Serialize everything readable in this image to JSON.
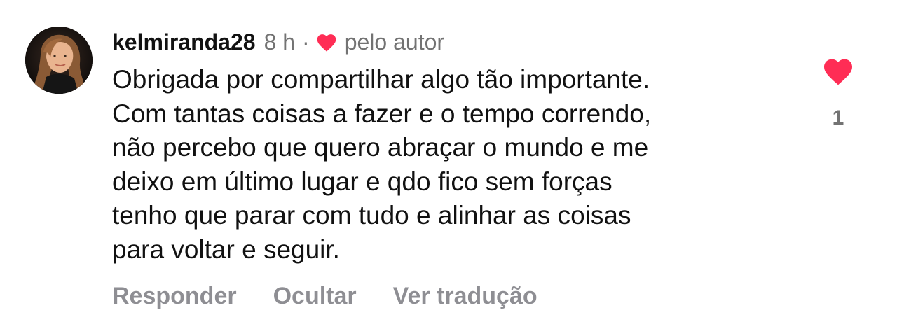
{
  "comment": {
    "username": "kelmiranda28",
    "time": "8 h",
    "separator": "·",
    "author_label": "pelo autor",
    "text_lines": [
      "Obrigada por compartilhar algo tão importante.",
      "Com tantas coisas a fazer e o tempo correndo,",
      "não percebo que quero abraçar o mundo e me",
      "deixo em último lugar e qdo fico sem forças",
      "tenho que parar com tudo e alinhar as coisas",
      "para voltar e seguir."
    ],
    "like_count": "1",
    "actions": {
      "reply": "Responder",
      "hide": "Ocultar",
      "translate": "Ver tradução"
    }
  },
  "colors": {
    "heart": "#ff2d55",
    "secondary_text": "#737373",
    "action_text": "#8e8e93"
  },
  "icons": {
    "author_heart": "heart-icon",
    "like": "heart-filled-icon"
  }
}
